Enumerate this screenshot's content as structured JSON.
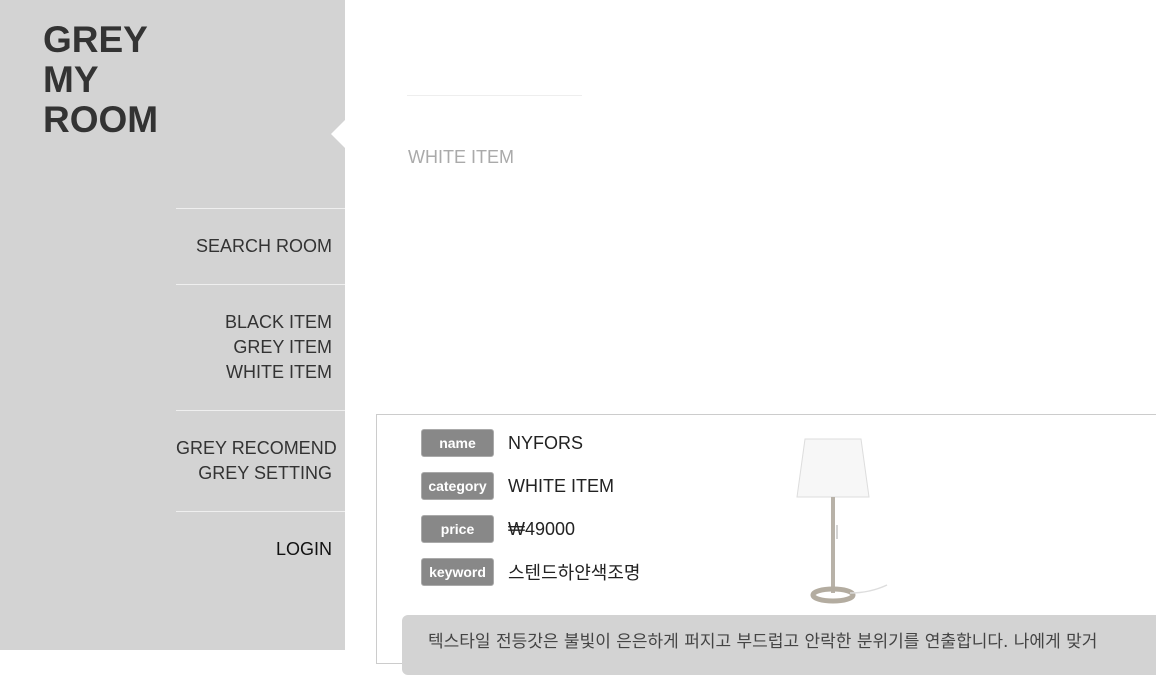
{
  "sidebar": {
    "logo_lines": [
      "GREY",
      "MY",
      "ROOM"
    ],
    "nav": {
      "search_room": "SEARCH ROOM",
      "black_item": "BLACK ITEM",
      "grey_item": "GREY ITEM",
      "white_item": "WHITE ITEM",
      "grey_recomend": "GREY RECOMEND",
      "grey_setting": "GREY SETTING",
      "login": "LOGIN"
    }
  },
  "main": {
    "section_title": "WHITE ITEM"
  },
  "product": {
    "labels": {
      "name": "name",
      "category": "category",
      "price": "price",
      "keyword": "keyword"
    },
    "name": "NYFORS",
    "category": "WHITE ITEM",
    "price": "₩49000",
    "keyword": "스텐드하얀색조명",
    "image_icon": "floor-lamp-icon",
    "description": "텍스타일 전등갓은 불빛이 은은하게 퍼지고 부드럽고 안락한 분위기를 연출합니다. 나에게 맞거"
  },
  "colors": {
    "sidebar_bg": "#d3d3d3",
    "label_bg": "#888888",
    "muted_text": "#aaaaaa"
  }
}
